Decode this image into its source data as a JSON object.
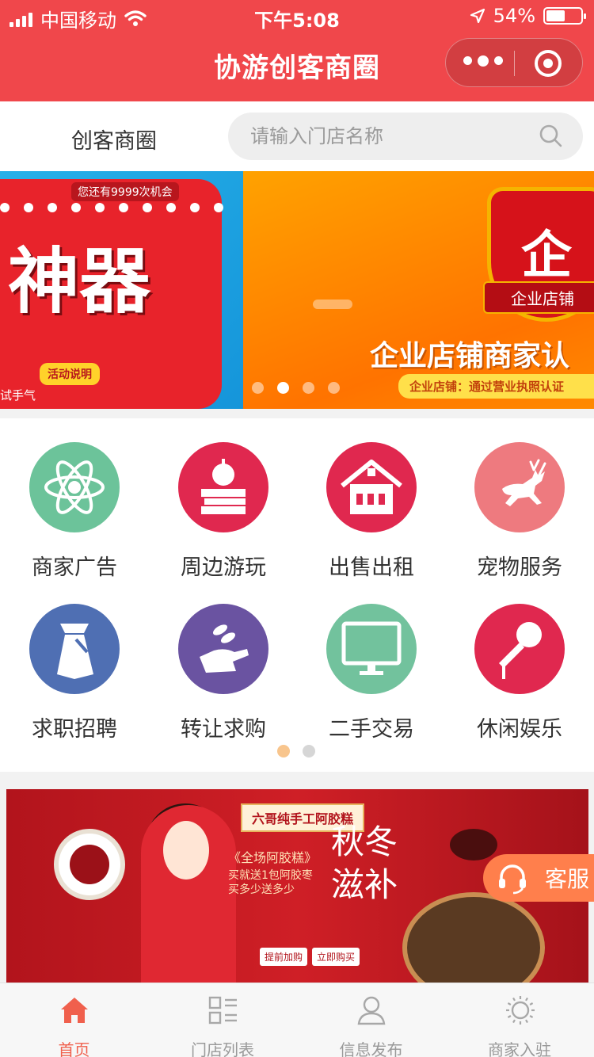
{
  "status_bar": {
    "carrier": "中国移动",
    "time": "下午5:08",
    "battery": "54%",
    "battery_level": 0.54
  },
  "nav": {
    "title": "协游创客商圈"
  },
  "search_row": {
    "brand": "创客商圈",
    "placeholder": "请输入门店名称"
  },
  "banner": {
    "slide_a": {
      "chance_text": "您还有9999次机会",
      "big_text": "神器",
      "pill": "活动说明",
      "lucky": "试手气"
    },
    "slide_b": {
      "badge_char": "企",
      "badge_label": "企业店铺",
      "headline": "企业店铺商家认",
      "sub": "企业店铺：通过营业执照认证"
    },
    "active_dot": 2,
    "dot_count": 4
  },
  "menu": {
    "items": [
      {
        "label": "商家广告",
        "color": "#6cc39a",
        "icon": "atom-icon"
      },
      {
        "label": "周边游玩",
        "color": "#e0284f",
        "icon": "apple-books-icon"
      },
      {
        "label": "出售出租",
        "color": "#e0284f",
        "icon": "house-icon"
      },
      {
        "label": "宠物服务",
        "color": "#ee7a7f",
        "icon": "deer-icon"
      },
      {
        "label": "求职招聘",
        "color": "#4f6fb3",
        "icon": "tie-icon"
      },
      {
        "label": "转让求购",
        "color": "#6a53a1",
        "icon": "hand-coins-icon"
      },
      {
        "label": "二手交易",
        "color": "#72c29d",
        "icon": "monitor-icon"
      },
      {
        "label": "休闲娱乐",
        "color": "#e0284f",
        "icon": "microphone-icon"
      }
    ],
    "page": 1,
    "page_count": 2
  },
  "ad": {
    "title": "六哥纯手工阿胶糕",
    "promo_heading": "《全场阿胶糕》",
    "promo_line1": "买就送1包阿胶枣",
    "promo_line2": "买多少送多少",
    "calligraphy": "秋冬滋补",
    "button1": "提前加购",
    "button2": "立即购买"
  },
  "service": {
    "label": "客服"
  },
  "tabbar": {
    "tabs": [
      {
        "label": "首页",
        "icon": "home-icon",
        "active": true
      },
      {
        "label": "门店列表",
        "icon": "list-icon",
        "active": false
      },
      {
        "label": "信息发布",
        "icon": "user-icon",
        "active": false
      },
      {
        "label": "商家入驻",
        "icon": "sun-icon",
        "active": false
      }
    ]
  },
  "colors": {
    "brand_red": "#f0474b",
    "tab_active": "#f0604d",
    "service_orange": "#ff7f4c",
    "pager_active": "#f8c58d"
  }
}
